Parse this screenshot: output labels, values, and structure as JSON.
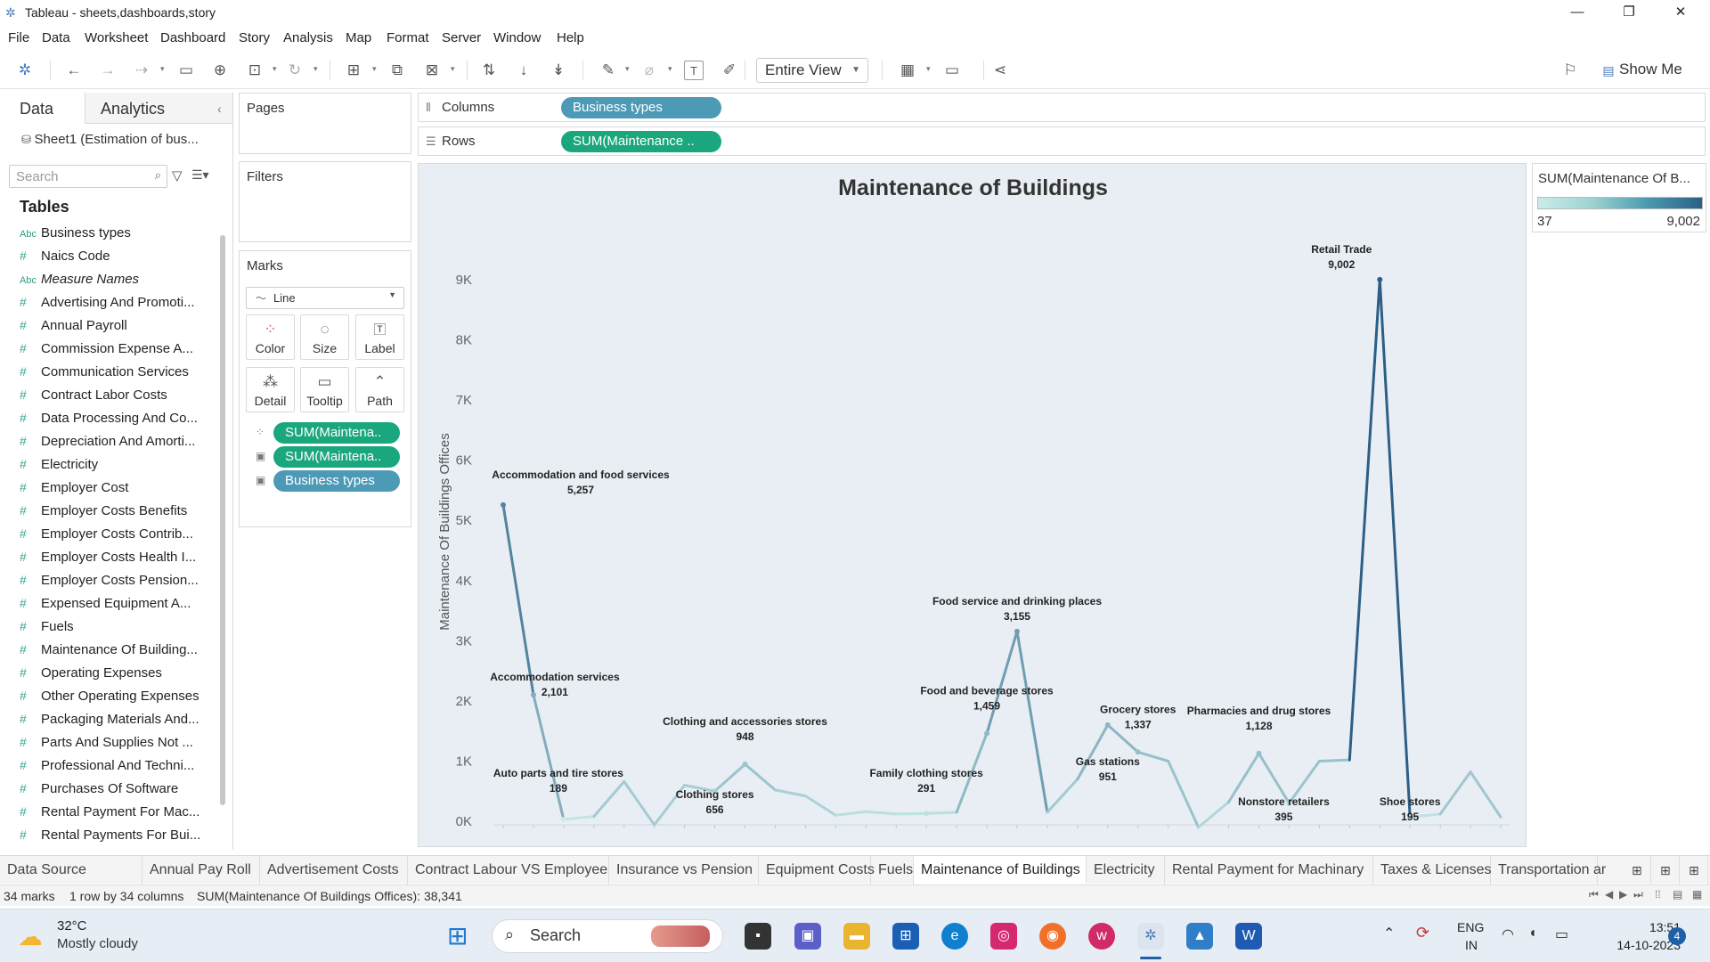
{
  "window": {
    "title": "Tableau - sheets,dashboards,story"
  },
  "menu": [
    "File",
    "Data",
    "Worksheet",
    "Dashboard",
    "Story",
    "Analysis",
    "Map",
    "Format",
    "Server",
    "Window",
    "Help"
  ],
  "toolbar": {
    "fit_select": "Entire View",
    "show_me": "Show Me"
  },
  "data_pane": {
    "tabs": [
      "Data",
      "Analytics"
    ],
    "datasource": "Sheet1 (Estimation of bus...",
    "search_placeholder": "Search",
    "tables_heading": "Tables",
    "fields": [
      {
        "name": "Business types",
        "type": "abc"
      },
      {
        "name": "Naics Code",
        "type": "num"
      },
      {
        "name": "Measure Names",
        "type": "abc",
        "italic": true
      },
      {
        "name": "Advertising And Promoti...",
        "type": "num"
      },
      {
        "name": "Annual Payroll",
        "type": "num"
      },
      {
        "name": "Commission Expense A...",
        "type": "num"
      },
      {
        "name": "Communication Services",
        "type": "num"
      },
      {
        "name": "Contract Labor Costs",
        "type": "num"
      },
      {
        "name": "Data Processing And Co...",
        "type": "num"
      },
      {
        "name": "Depreciation And Amorti...",
        "type": "num"
      },
      {
        "name": "Electricity",
        "type": "num"
      },
      {
        "name": "Employer Cost",
        "type": "num"
      },
      {
        "name": "Employer Costs Benefits",
        "type": "num"
      },
      {
        "name": "Employer Costs Contrib...",
        "type": "num"
      },
      {
        "name": "Employer Costs Health I...",
        "type": "num"
      },
      {
        "name": "Employer Costs Pension...",
        "type": "num"
      },
      {
        "name": "Expensed Equipment A...",
        "type": "num"
      },
      {
        "name": "Fuels",
        "type": "num"
      },
      {
        "name": "Maintenance Of Building...",
        "type": "num"
      },
      {
        "name": "Operating Expenses",
        "type": "num"
      },
      {
        "name": "Other Operating Expenses",
        "type": "num"
      },
      {
        "name": "Packaging Materials And...",
        "type": "num"
      },
      {
        "name": "Parts And Supplies Not ...",
        "type": "num"
      },
      {
        "name": "Professional And Techni...",
        "type": "num"
      },
      {
        "name": "Purchases Of Software",
        "type": "num"
      },
      {
        "name": "Rental Payment For Mac...",
        "type": "num"
      },
      {
        "name": "Rental Payments For Bui...",
        "type": "num"
      }
    ]
  },
  "cards": {
    "pages": "Pages",
    "filters": "Filters",
    "marks": "Marks",
    "mark_type": "Line",
    "mark_buttons": [
      "Color",
      "Size",
      "Label",
      "Detail",
      "Tooltip",
      "Path"
    ],
    "mark_pills": [
      "SUM(Maintena..",
      "SUM(Maintena..",
      "Business types"
    ]
  },
  "shelves": {
    "columns_label": "Columns",
    "columns_pill": "Business types",
    "rows_label": "Rows",
    "rows_pill": "SUM(Maintenance .."
  },
  "legend": {
    "title": "SUM(Maintenance Of B...",
    "min": "37",
    "max": "9,002"
  },
  "chart_data": {
    "type": "line",
    "title": "Maintenance of Buildings",
    "ylabel": "Maintenance Of Buildings Offices",
    "xlabel": "",
    "ylim": [
      0,
      9000
    ],
    "yticks": [
      "0K",
      "1K",
      "2K",
      "3K",
      "4K",
      "5K",
      "6K",
      "7K",
      "8K",
      "9K"
    ],
    "values": [
      5257,
      2101,
      30,
      80,
      660,
      -60,
      600,
      500,
      948,
      520,
      420,
      100,
      160,
      120,
      130,
      150,
      1459,
      3155,
      150,
      700,
      1600,
      1150,
      1000,
      -100,
      320,
      1128,
      300,
      1000,
      1020,
      9002,
      70,
      120,
      820,
      70
    ],
    "labels": [
      {
        "index": 0,
        "name": "Accommodation and food services",
        "value": "5,257"
      },
      {
        "index": 1,
        "name": "Accommodation services",
        "value": "2,101"
      },
      {
        "index": 2,
        "name": "Auto parts and tire stores",
        "value": "189"
      },
      {
        "index": 8,
        "name": "Clothing and accessories stores",
        "value": "948"
      },
      {
        "index": 7,
        "name": "Clothing stores",
        "value": "656"
      },
      {
        "index": 14,
        "name": "Family clothing stores",
        "value": "291"
      },
      {
        "index": 16,
        "name": "Food and beverage stores",
        "value": "1,459"
      },
      {
        "index": 17,
        "name": "Food service and drinking places",
        "value": "3,155"
      },
      {
        "index": 20,
        "name": "Gas stations",
        "value": "951"
      },
      {
        "index": 21,
        "name": "Grocery stores",
        "value": "1,337"
      },
      {
        "index": 26,
        "name": "Nonstore retailers",
        "value": "395"
      },
      {
        "index": 25,
        "name": "Pharmacies and drug stores",
        "value": "1,128"
      },
      {
        "index": 29,
        "name": "Retail Trade",
        "value": "9,002"
      },
      {
        "index": 30,
        "name": "Shoe stores",
        "value": "195"
      }
    ],
    "color_min": 37,
    "color_max": 9002,
    "colors": {
      "low": "#c9ece9",
      "high": "#2c5f86"
    }
  },
  "sheet_tabs": [
    "Data Source",
    "Annual Pay Roll",
    "Advertisement Costs",
    "Contract Labour VS Employee",
    "Insurance vs Pension",
    "Equipment Costs",
    "Fuels",
    "Maintenance of Buildings",
    "Electricity",
    "Rental Payment for Machinary",
    "Taxes & Licenses",
    "Transportation ar"
  ],
  "active_tab": "Maintenance of Buildings",
  "status": {
    "marks": "34 marks",
    "dims": "1 row by 34 columns",
    "sum": "SUM(Maintenance Of Buildings Offices): 38,341"
  },
  "taskbar": {
    "weather_temp": "32°C",
    "weather_desc": "Mostly cloudy",
    "search": "Search",
    "lang1": "ENG",
    "lang2": "IN",
    "time": "13:51",
    "date": "14-10-2023",
    "notif_count": "4"
  }
}
